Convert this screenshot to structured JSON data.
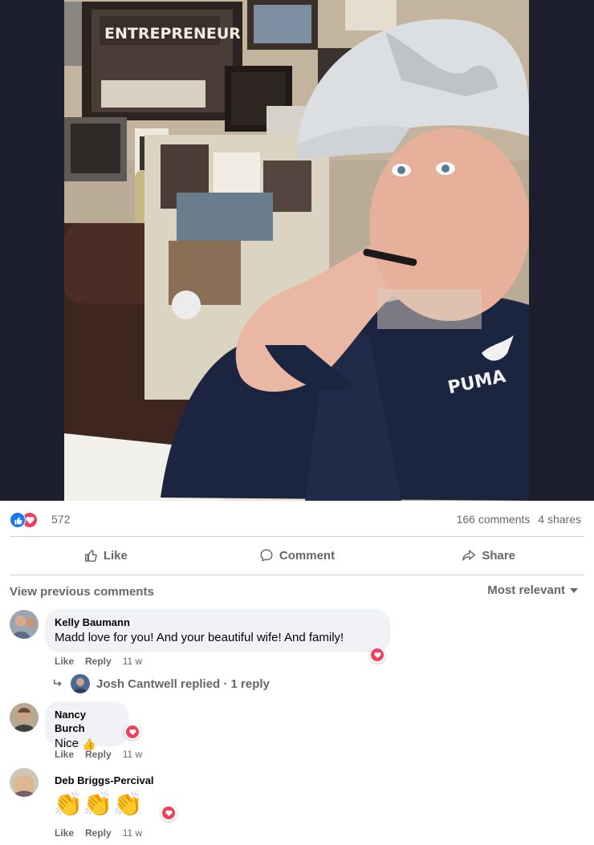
{
  "post": {
    "image_alt": "Man in white cap and navy PUMA hoodie holding a pen to his mouth in an office",
    "poster_text": "ENTREPRENEUR",
    "hoodie_brand": "PUMA"
  },
  "stats": {
    "reaction_count": "572",
    "comments": "166 comments",
    "shares": "4 shares",
    "reaction_icons": [
      "like-icon",
      "love-icon"
    ]
  },
  "actions": {
    "like_label": "Like",
    "comment_label": "Comment",
    "share_label": "Share"
  },
  "comments_header": {
    "view_previous": "View previous comments",
    "sort_label": "Most relevant"
  },
  "comments": [
    {
      "name": "Kelly Baumann",
      "text": "Madd love for you! And your beautiful wife! And family!",
      "like": "Like",
      "reply": "Reply",
      "time": "11 w",
      "reaction": "love-icon"
    },
    {
      "name": "Nancy Burch",
      "text": "Nice",
      "emoji": "👍",
      "like": "Like",
      "reply": "Reply",
      "time": "11 w",
      "reaction": "love-icon"
    },
    {
      "name": "Deb Briggs-Percival",
      "emoji_text": "👏👏👏",
      "like": "Like",
      "reply": "Reply",
      "time": "11 w",
      "reaction": "love-icon"
    }
  ],
  "reply_thread": {
    "text": "Josh Cantwell replied · 1 reply"
  },
  "colors": {
    "brand_blue": "#1877f2",
    "love_red": "#f33e58",
    "muted_text": "#65676b",
    "bubble_bg": "#f0f2f5",
    "photo_band": "#1c1e2e"
  }
}
